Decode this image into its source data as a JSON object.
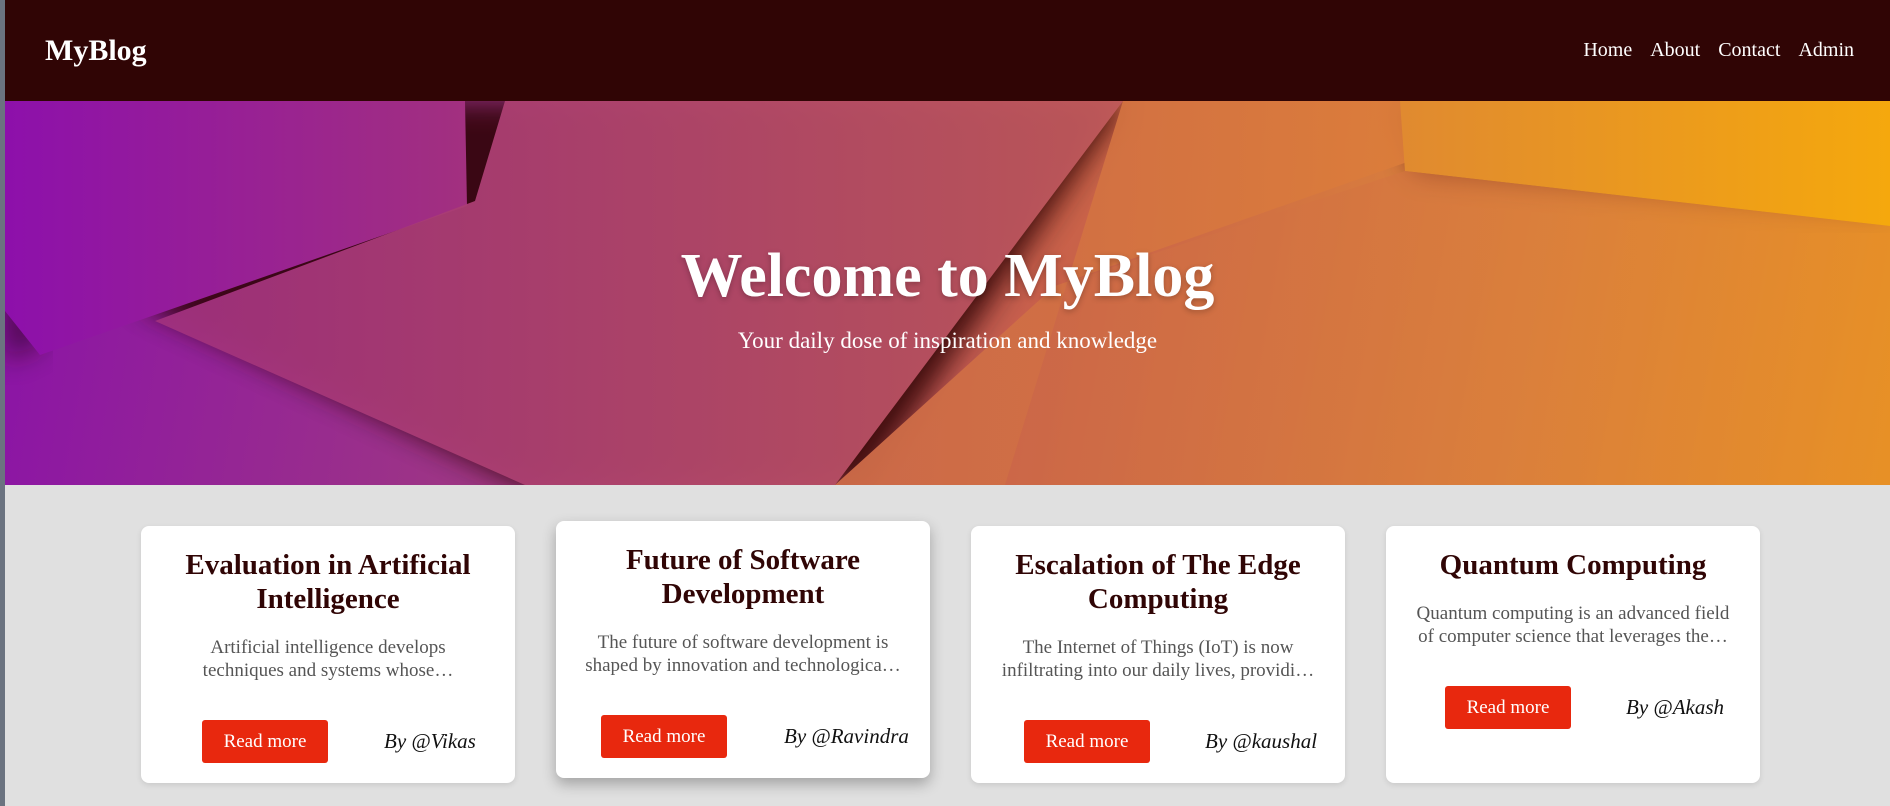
{
  "navbar": {
    "brand": "MyBlog",
    "links": [
      "Home",
      "About",
      "Contact",
      "Admin"
    ]
  },
  "hero": {
    "title": "Welcome to MyBlog",
    "subtitle": "Your daily dose of inspiration and knowledge"
  },
  "posts": [
    {
      "title": "Evaluation in Artificial Intelligence",
      "excerpt": "Artificial intelligence develops techniques and systems whose…",
      "button": "Read more",
      "author": "By @Vikas"
    },
    {
      "title": "Future of Software Development",
      "excerpt": "The future of software development is shaped by innovation and technologica…",
      "button": "Read more",
      "author": "By @Ravindra"
    },
    {
      "title": "Escalation of The Edge Computing",
      "excerpt": "The Internet of Things (IoT) is now infiltrating into our daily lives, providi…",
      "button": "Read more",
      "author": "By @kaushal"
    },
    {
      "title": "Quantum Computing",
      "excerpt": "Quantum computing is an advanced field of computer science that leverages the…",
      "button": "Read more",
      "author": "By @Akash"
    }
  ],
  "colors": {
    "navbar_bg": "#300505",
    "accent_button": "#e8280e",
    "page_bg": "#e0e0e0",
    "card_title": "#300505"
  }
}
